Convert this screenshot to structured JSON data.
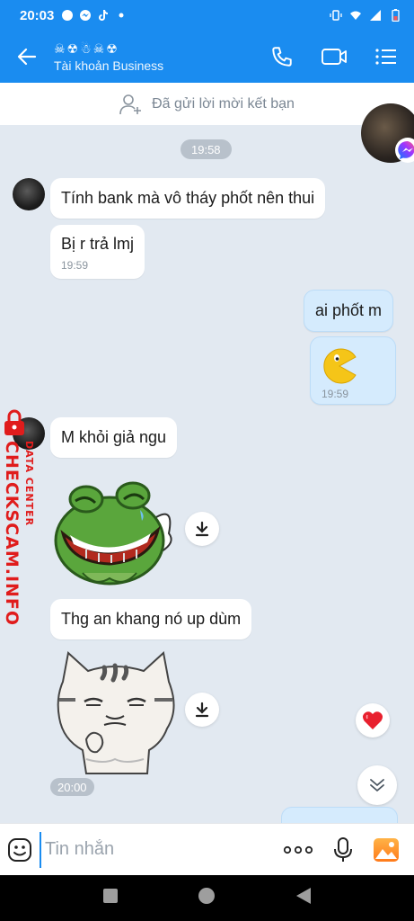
{
  "status_bar": {
    "time": "20:03"
  },
  "header": {
    "contact_name": "☠☢☃☠☢",
    "contact_subtitle": "Tài khoản Business"
  },
  "friend_banner": {
    "text": "Đã gửi lời mời kết bạn"
  },
  "timestamps": {
    "top": "19:58",
    "bottom": "20:00"
  },
  "messages": [
    {
      "direction": "in",
      "text": "Tính bank mà vô tháy phốt nên thui"
    },
    {
      "direction": "in",
      "text": "Bị r trả lmj",
      "time": "19:59"
    },
    {
      "direction": "out",
      "text": "ai phốt m"
    },
    {
      "direction": "out",
      "sticker": "pacman-sticker",
      "time": "19:59"
    },
    {
      "direction": "in",
      "text": "M khỏi giả ngu"
    },
    {
      "direction": "in",
      "sticker": "laughing-frog-sticker"
    },
    {
      "direction": "in",
      "text": "Thg an khang nó up dùm"
    },
    {
      "direction": "in",
      "sticker": "grumpy-cat-sticker"
    }
  ],
  "composer": {
    "placeholder": "Tin nhắn"
  },
  "watermark": {
    "brand": "CHECKSCAM.INFO",
    "tagline": "DATA CENTER"
  },
  "colors": {
    "header": "#1a8cf0",
    "chat_bg": "#e2e9f1",
    "outgoing_bubble": "#d5ebfd",
    "watermark": "#e01c1c"
  },
  "icons": [
    "back-arrow-icon",
    "phone-icon",
    "video-call-icon",
    "menu-list-icon",
    "add-friend-icon",
    "download-icon",
    "heart-icon",
    "chevron-double-down-icon",
    "emoji-icon",
    "more-icon",
    "microphone-icon",
    "image-icon",
    "nav-square-icon",
    "nav-circle-icon",
    "nav-triangle-icon",
    "messenger-icon"
  ]
}
